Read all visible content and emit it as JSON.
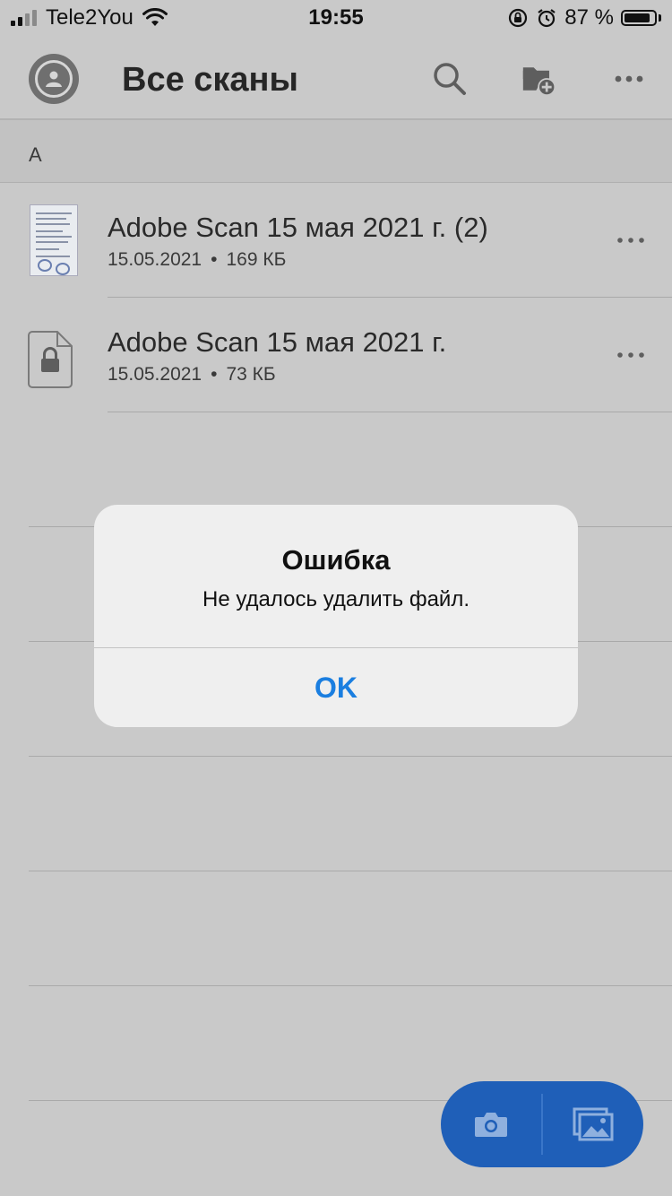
{
  "status_bar": {
    "carrier": "Tele2You",
    "time": "19:55",
    "battery_percent": "87 %",
    "battery_level": 0.87,
    "icons": [
      "signal-icon",
      "wifi-icon",
      "rotation-lock-icon",
      "alarm-icon",
      "battery-icon"
    ]
  },
  "header": {
    "title": "Все сканы",
    "icons": [
      "avatar-icon",
      "search-icon",
      "new-folder-icon",
      "more-icon"
    ]
  },
  "section": {
    "letter": "A"
  },
  "files": [
    {
      "name": "Adobe Scan 15 мая 2021 г. (2)",
      "date": "15.05.2021",
      "separator": "•",
      "size": "169 КБ",
      "thumbnail": "document-thumbnail"
    },
    {
      "name": "Adobe Scan 15 мая 2021 г.",
      "date": "15.05.2021",
      "separator": "•",
      "size": "73 КБ",
      "thumbnail": "locked-document-icon"
    }
  ],
  "alert": {
    "title": "Ошибка",
    "message": "Не удалось удалить файл.",
    "ok_label": "OK"
  },
  "fab": {
    "icons": [
      "camera-icon",
      "gallery-icon"
    ]
  },
  "colors": {
    "background": "#c9c9c9",
    "accent_blue": "#1a7ee0",
    "fab_blue": "#1f5fb8",
    "alert_background": "#efefef"
  }
}
